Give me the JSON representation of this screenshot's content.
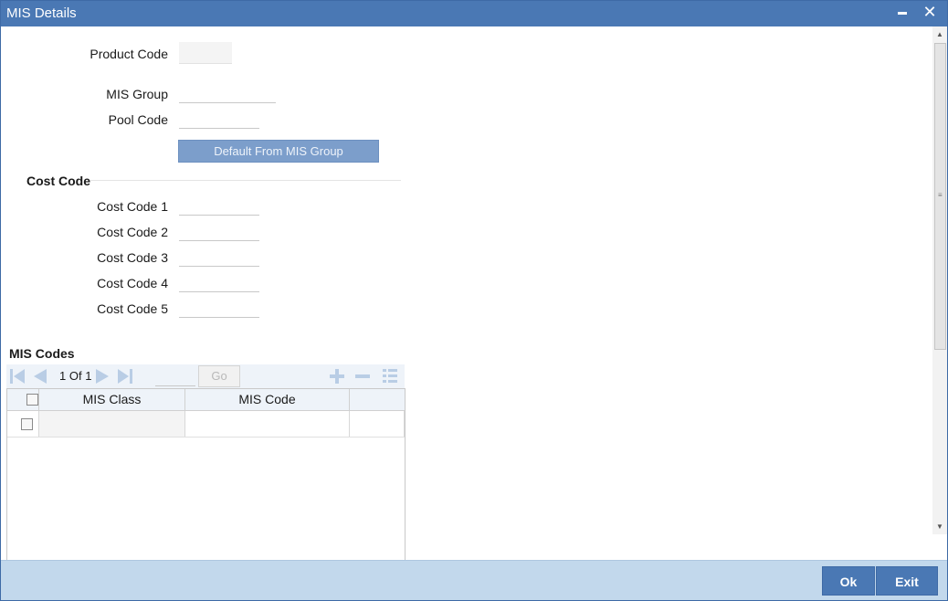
{
  "window": {
    "title": "MIS Details",
    "minimize_glyph": "▬",
    "close_glyph": "✕"
  },
  "form": {
    "product_code": {
      "label": "Product Code",
      "value": ""
    },
    "mis_group": {
      "label": "MIS Group",
      "value": ""
    },
    "pool_code": {
      "label": "Pool Code",
      "value": ""
    },
    "default_button": "Default From MIS Group"
  },
  "cost_code": {
    "section_title": "Cost Code",
    "fields": [
      {
        "label": "Cost Code 1",
        "value": ""
      },
      {
        "label": "Cost Code 2",
        "value": ""
      },
      {
        "label": "Cost Code 3",
        "value": ""
      },
      {
        "label": "Cost Code 4",
        "value": ""
      },
      {
        "label": "Cost Code 5",
        "value": ""
      }
    ]
  },
  "mis_codes": {
    "section_title": "MIS Codes",
    "pagination": {
      "current": "1",
      "of_label": "Of",
      "total": "1",
      "go_label": "Go"
    },
    "columns": [
      "MIS Class",
      "MIS Code"
    ],
    "rows": [
      {
        "mis_class": "",
        "mis_code": ""
      }
    ]
  },
  "footer": {
    "ok_label": "Ok",
    "exit_label": "Exit"
  },
  "colors": {
    "title_bar": "#4a78b4",
    "footer_bar": "#c2d8ec",
    "accent_button": "#4a78b4"
  }
}
